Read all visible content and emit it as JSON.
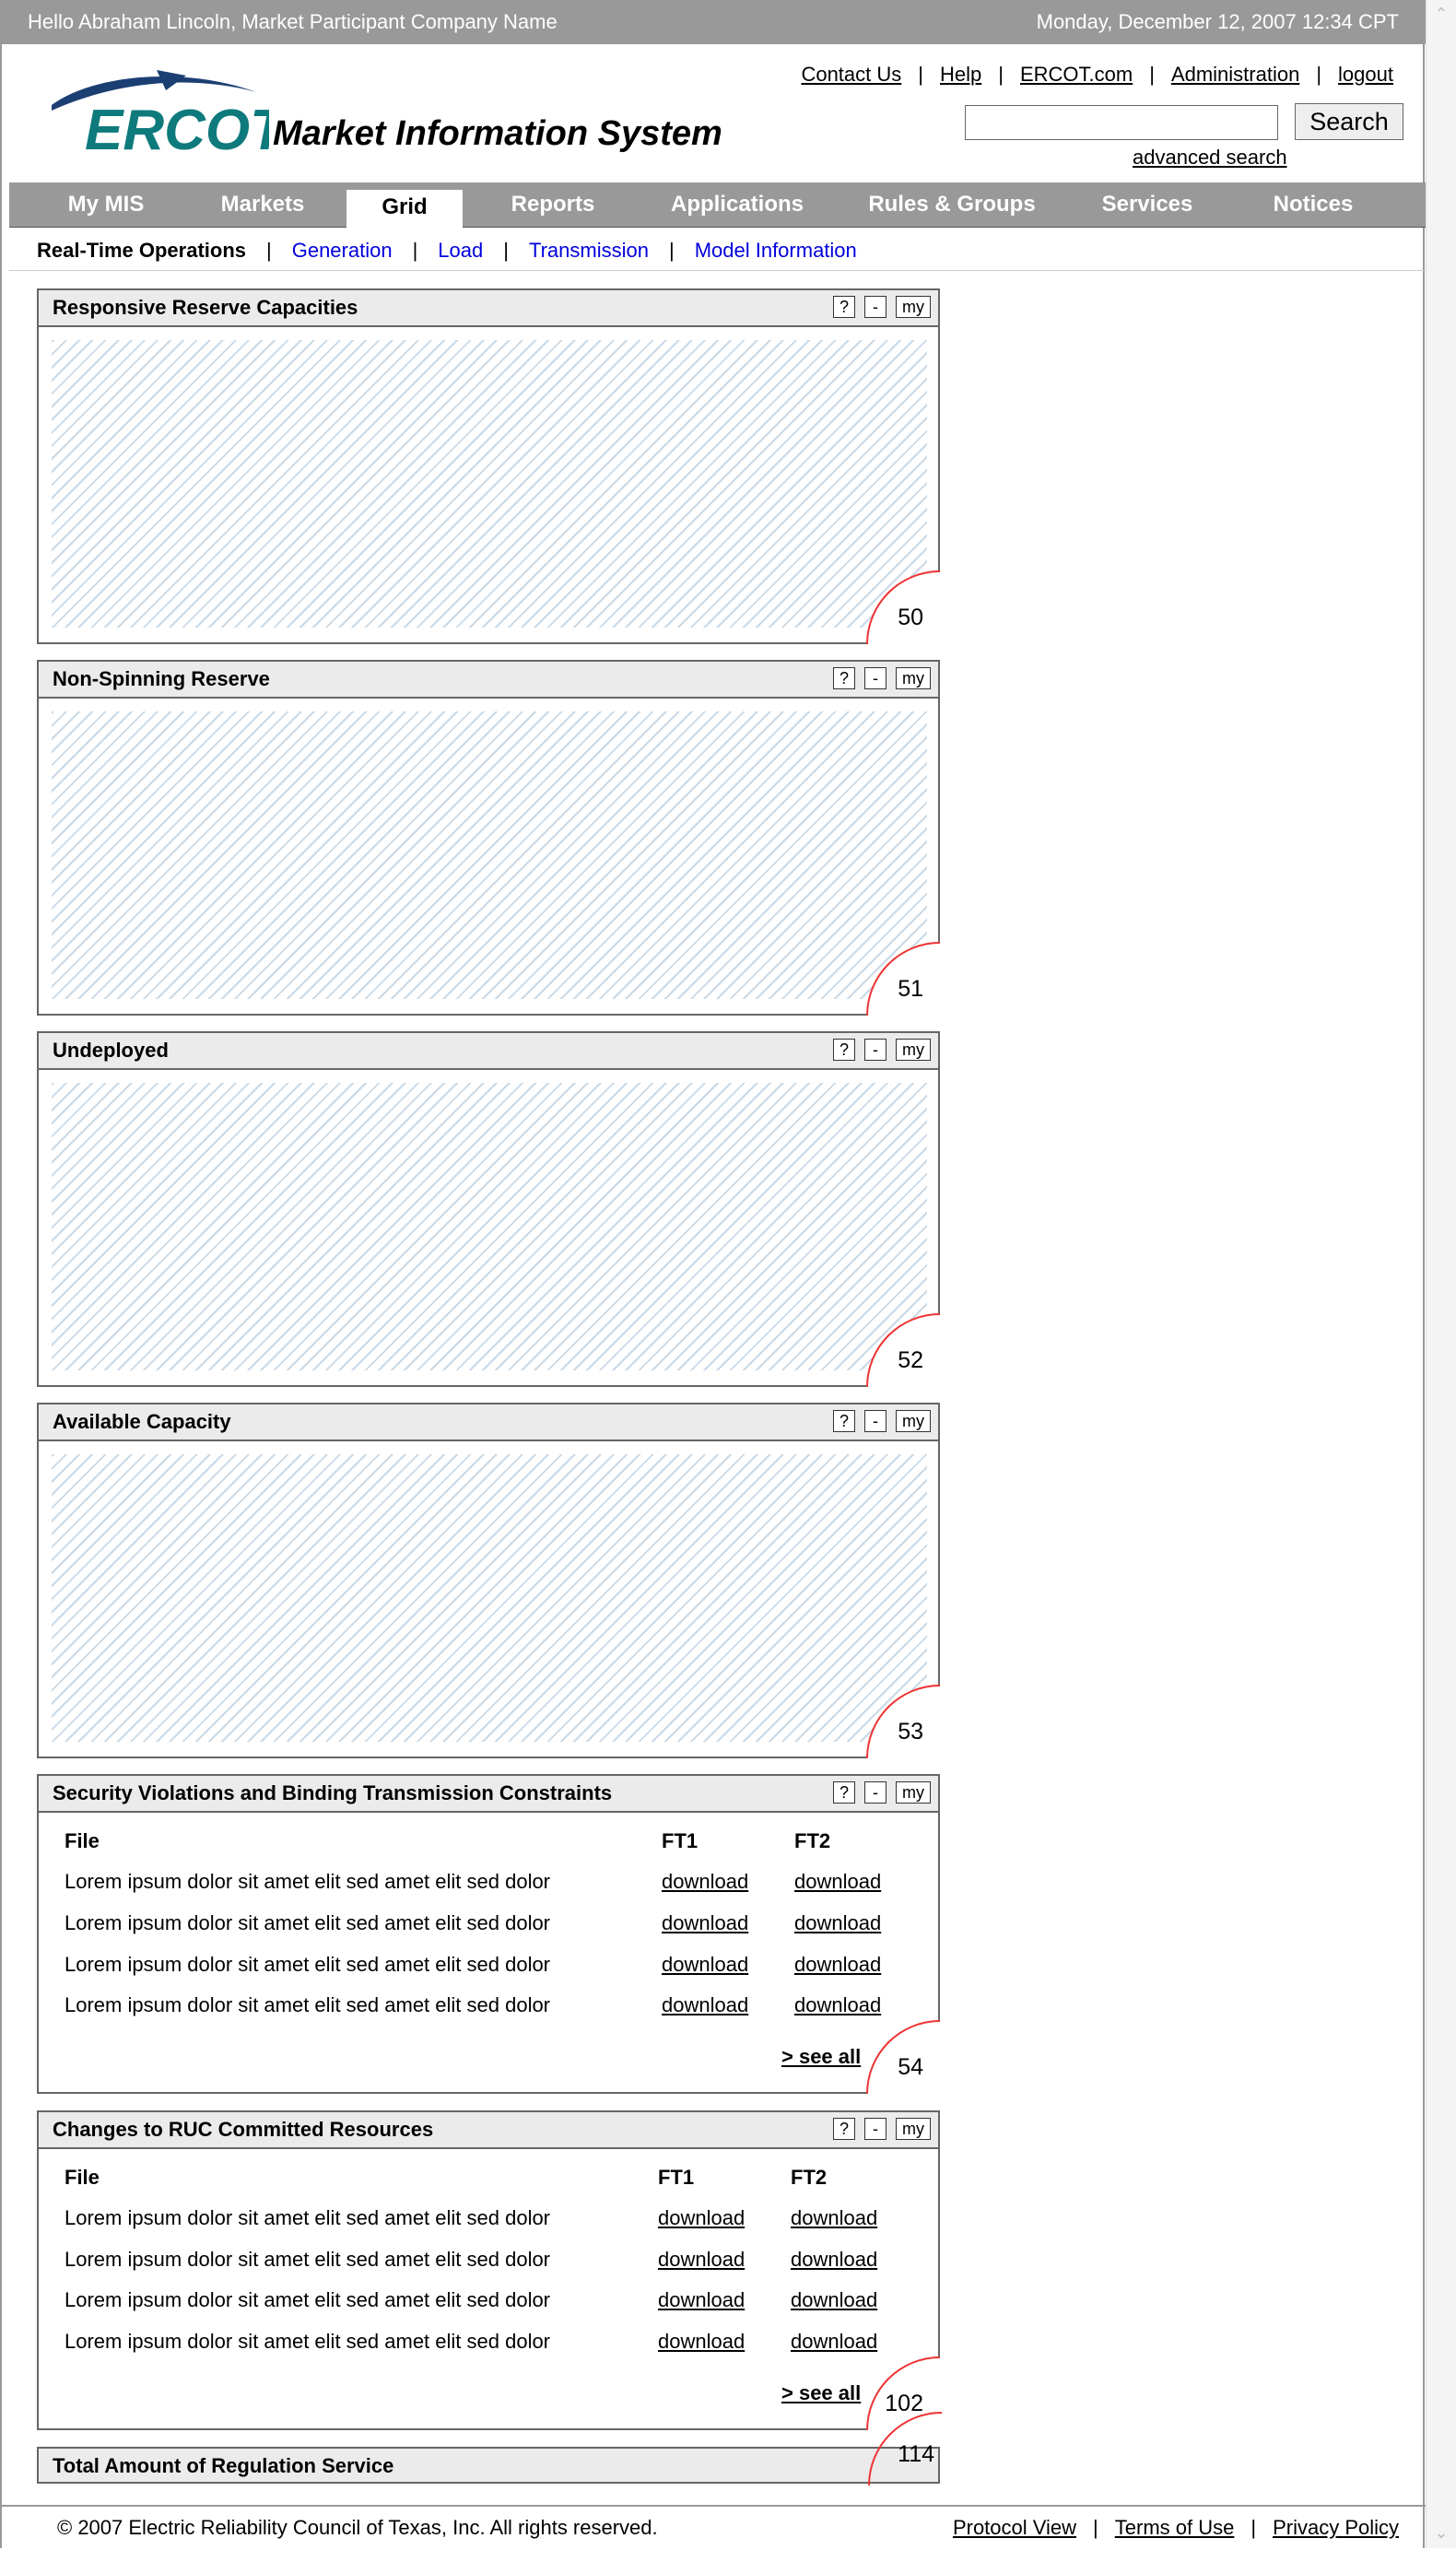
{
  "topbar": {
    "greeting": "Hello Abraham Lincoln, Market Participant Company Name",
    "datetime": "Monday, December 12, 2007   12:34 CPT"
  },
  "header": {
    "logo_text": "ERCOT",
    "app_title": "Market Information System",
    "links": [
      "Contact Us",
      "Help",
      "ERCOT.com",
      "Administration",
      "logout"
    ],
    "search": {
      "value": "",
      "button": "Search",
      "advanced": "advanced search"
    }
  },
  "nav": {
    "tabs": [
      "My MIS",
      "Markets",
      "Grid",
      "Reports",
      "Applications",
      "Rules & Groups",
      "Services",
      "Notices"
    ],
    "active": "Grid"
  },
  "subnav": {
    "current": "Real-Time Operations",
    "links": [
      "Generation",
      "Load",
      "Transmission",
      "Model Information"
    ]
  },
  "panel_buttons": {
    "help": "?",
    "minimize": "-",
    "my": "my"
  },
  "panels": [
    {
      "title": "Responsive Reserve Capacities",
      "badge": "50"
    },
    {
      "title": "Non-Spinning Reserve",
      "badge": "51"
    },
    {
      "title": "Undeployed",
      "badge": "52"
    },
    {
      "title": "Available Capacity",
      "badge": "53"
    },
    {
      "title": "Security Violations and Binding Transmission Constraints",
      "badge": "54",
      "columns": [
        "File",
        "FT1",
        "FT2"
      ],
      "rows": [
        [
          "Lorem ipsum dolor sit amet elit sed amet elit sed dolor",
          "download",
          "download"
        ],
        [
          "Lorem ipsum dolor sit amet elit sed amet elit sed dolor",
          "download",
          "download"
        ],
        [
          "Lorem ipsum dolor sit amet elit sed amet elit sed dolor",
          "download",
          "download"
        ],
        [
          "Lorem ipsum dolor sit amet elit sed amet elit sed dolor",
          "download",
          "download"
        ]
      ],
      "see_all": "> see all"
    },
    {
      "title": "Changes to RUC Committed Resources",
      "badge": "102",
      "columns": [
        "File",
        "FT1",
        "FT2"
      ],
      "rows": [
        [
          "Lorem ipsum dolor sit amet elit sed amet elit sed dolor",
          "download",
          "download"
        ],
        [
          "Lorem ipsum dolor sit amet elit sed amet elit sed dolor",
          "download",
          "download"
        ],
        [
          "Lorem ipsum dolor sit amet elit sed amet elit sed dolor",
          "download",
          "download"
        ],
        [
          "Lorem ipsum dolor sit amet elit sed amet elit sed dolor",
          "download",
          "download"
        ]
      ],
      "see_all": "> see all"
    },
    {
      "title": "Total Amount of Regulation Service",
      "badge": "114"
    }
  ],
  "footer": {
    "copyright": "© 2007 Electric Reliability Council of Texas, Inc.  All rights reserved.",
    "links": [
      "Protocol View",
      "Terms of Use",
      "Privacy Policy"
    ]
  },
  "colors": {
    "topbar": "#999999",
    "logo_teal": "#0e7a7c",
    "logo_navy": "#1b3f73",
    "subnav_link": "#0000dd",
    "badge_outline": "#ee3333"
  }
}
